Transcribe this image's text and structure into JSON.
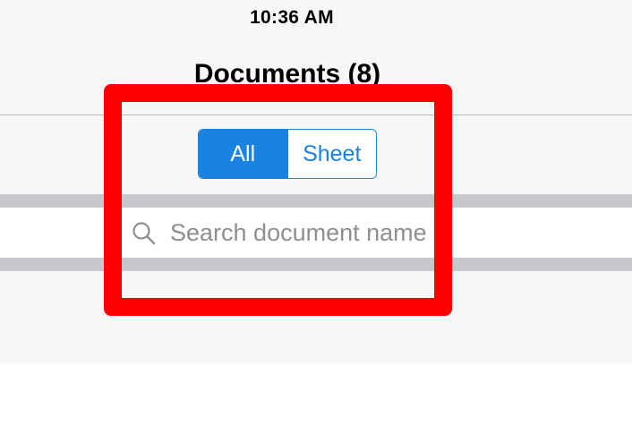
{
  "status_bar": {
    "time": "10:36 AM"
  },
  "nav": {
    "title": "Documents (8)"
  },
  "filter": {
    "segments": [
      {
        "label": "All",
        "selected": true
      },
      {
        "label": "Sheet",
        "selected": false
      }
    ]
  },
  "search": {
    "placeholder": "Search document name",
    "value": "",
    "icon": "search-icon"
  },
  "colors": {
    "accent": "#1a82e2",
    "highlight": "#ff0000",
    "band": "#c8c7cc"
  }
}
